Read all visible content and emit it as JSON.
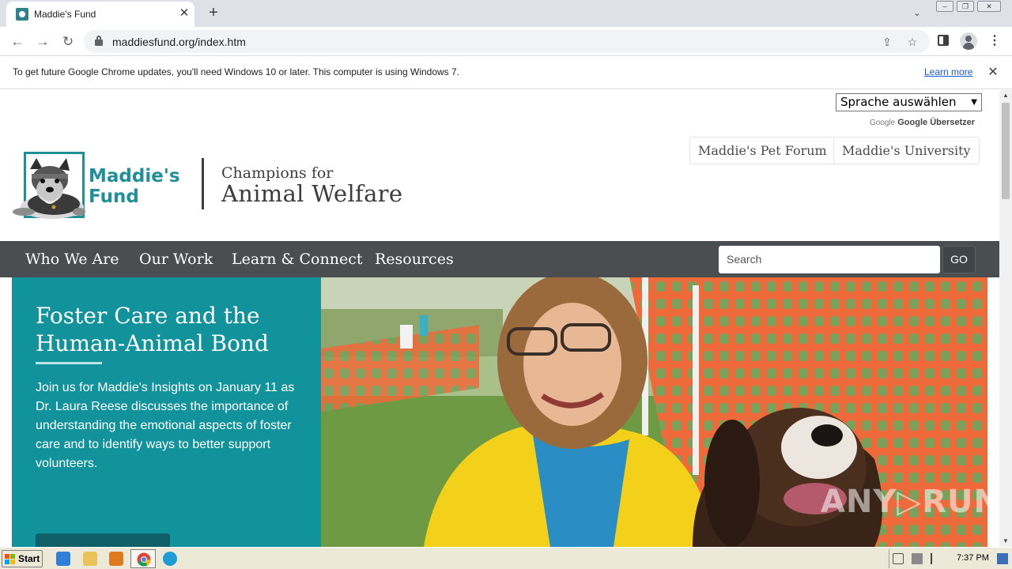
{
  "browser": {
    "tab": {
      "title": "Maddie's Fund",
      "close": "✕"
    },
    "new_tab": "+",
    "address": "maddiesfund.org/index.htm",
    "infobar": {
      "message": "To get future Google Chrome updates, you'll need Windows 10 or later. This computer is using Windows 7.",
      "link": "Learn more",
      "close": "✕"
    }
  },
  "page": {
    "translate": {
      "select_label": "Sprache auswählen",
      "brand_logo": "Google",
      "brand_name": "Google Übersetzer"
    },
    "top_links": [
      "Maddie's Pet Forum",
      "Maddie's University"
    ],
    "logo": {
      "name_line1": "Maddie's",
      "name_line2": "Fund"
    },
    "tagline": {
      "line1": "Champions for",
      "line2": "Animal Welfare"
    },
    "nav": [
      "Who We Are",
      "Our Work",
      "Learn & Connect",
      "Resources"
    ],
    "search": {
      "placeholder": "Search",
      "button": "GO"
    },
    "hero": {
      "title": "Foster Care and the Human-Animal Bond",
      "body": "Join us for Maddie's Insights on January 11 as Dr. Laura Reese discusses the importance of understanding the emotional aspects of foster care and to identify ways to better support volunteers."
    },
    "watermark": "ANY▷RUN"
  },
  "taskbar": {
    "start": "Start",
    "clock": "7:37 PM"
  },
  "colors": {
    "brand_teal": "#1f8f98",
    "hero_teal": "#12939c",
    "nav_bg": "#4a4e50"
  }
}
